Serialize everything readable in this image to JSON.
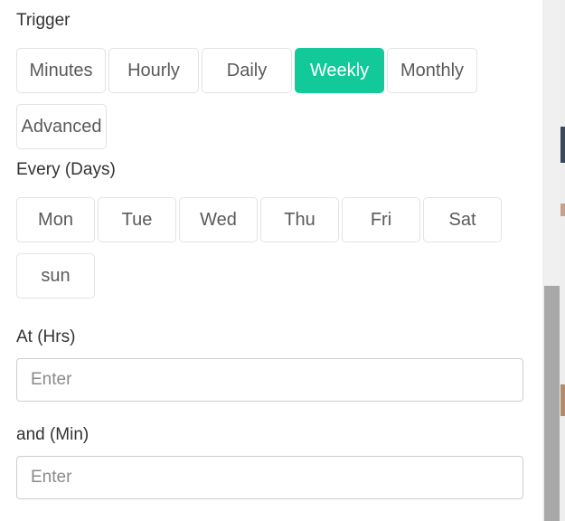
{
  "trigger": {
    "label": "Trigger",
    "options": [
      "Minutes",
      "Hourly",
      "Daily",
      "Weekly",
      "Monthly",
      "Advanced"
    ],
    "selected": "Weekly"
  },
  "every": {
    "label": "Every (Days)",
    "days": [
      "Mon",
      "Tue",
      "Wed",
      "Thu",
      "Fri",
      "Sat",
      "sun"
    ]
  },
  "at_hrs": {
    "label": "At (Hrs)",
    "placeholder": "Enter",
    "value": ""
  },
  "and_min": {
    "label": "and (Min)",
    "placeholder": "Enter",
    "value": ""
  },
  "colors": {
    "accent": "#12c99a",
    "border": "#e3e3e3",
    "text": "#333333",
    "scroll_thumb": "#a8a8a8"
  }
}
